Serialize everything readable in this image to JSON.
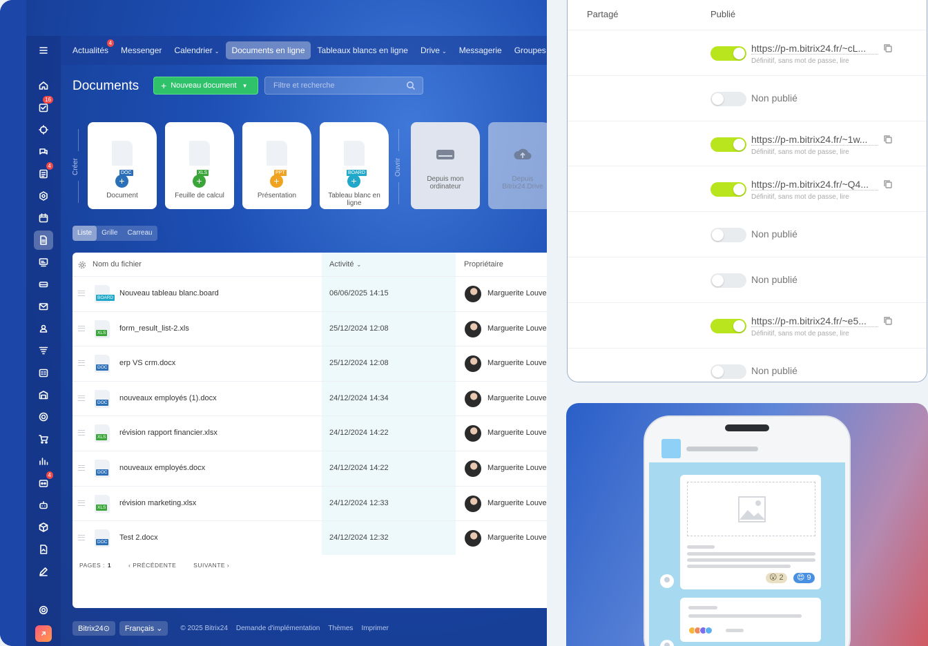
{
  "nav": {
    "items": [
      {
        "label": "Actualités",
        "badge": "4"
      },
      {
        "label": "Messenger"
      },
      {
        "label": "Calendrier",
        "caret": "⌄"
      },
      {
        "label": "Documents en ligne",
        "active": true
      },
      {
        "label": "Tableaux blancs en ligne"
      },
      {
        "label": "Drive",
        "caret": "⌄"
      },
      {
        "label": "Messagerie"
      },
      {
        "label": "Groupes"
      }
    ]
  },
  "sidebar": {
    "badge_tasks": "16",
    "badge_feed": "4",
    "badge_robot": "4"
  },
  "page": {
    "title": "Documents",
    "new_button": "Nouveau document",
    "search_placeholder": "Filtre et recherche"
  },
  "create": {
    "section_label": "Créer",
    "open_label": "Ouvrir",
    "cards": [
      {
        "label": "Document",
        "tag": "DOC"
      },
      {
        "label": "Feuille de calcul",
        "tag": "XLS"
      },
      {
        "label": "Présentation",
        "tag": "PPT"
      },
      {
        "label": "Tableau blanc en ligne",
        "tag": "BOARD"
      }
    ],
    "open_cards": [
      {
        "label": "Depuis mon ordinateur"
      },
      {
        "label": "Depuis Bitrix24.Drive"
      }
    ]
  },
  "view_tabs": [
    "Liste",
    "Grille",
    "Carreau"
  ],
  "table": {
    "col_name": "Nom du fichier",
    "col_activity": "Activité",
    "col_owner": "Propriétaire",
    "rows": [
      {
        "name": "Nouveau tableau blanc.board",
        "tag": "BOARD",
        "date": "06/06/2025 14:15",
        "owner": "Marguerite Louve"
      },
      {
        "name": "form_result_list-2.xls",
        "tag": "XLS",
        "date": "25/12/2024 12:08",
        "owner": "Marguerite Louve"
      },
      {
        "name": "erp VS crm.docx",
        "tag": "DOC",
        "date": "25/12/2024 12:08",
        "owner": "Marguerite Louve"
      },
      {
        "name": "nouveaux employés (1).docx",
        "tag": "DOC",
        "date": "24/12/2024 14:34",
        "owner": "Marguerite Louve"
      },
      {
        "name": "révision rapport financier.xlsx",
        "tag": "XLS",
        "date": "24/12/2024 14:22",
        "owner": "Marguerite Louve"
      },
      {
        "name": "nouveaux employés.docx",
        "tag": "DOC",
        "date": "24/12/2024 14:22",
        "owner": "Marguerite Louve"
      },
      {
        "name": "révision marketing.xlsx",
        "tag": "XLS",
        "date": "24/12/2024 12:33",
        "owner": "Marguerite Louve"
      },
      {
        "name": "Test 2.docx",
        "tag": "DOC",
        "date": "24/12/2024 12:32",
        "owner": "Marguerite Louve"
      }
    ],
    "pages_label": "PAGES :",
    "page_number": "1",
    "prev_label": "PRÉCÉDENTE",
    "next_label": "SUIVANTE"
  },
  "footer": {
    "brand": "Bitrix24",
    "language": "Français",
    "copyright": "© 2025 Bitrix24",
    "link_impl": "Demande d'implémentation",
    "link_themes": "Thèmes",
    "link_print": "Imprimer"
  },
  "publish": {
    "col_shared": "Partagé",
    "col_published": "Publié",
    "rows": [
      {
        "published": true,
        "link": "https://p-m.bitrix24.fr/~cL...",
        "sub": "Définitif, sans mot de passe, lire"
      },
      {
        "published": false,
        "label": "Non publié"
      },
      {
        "published": true,
        "link": "https://p-m.bitrix24.fr/~1w...",
        "sub": "Définitif, sans mot de passe, lire"
      },
      {
        "published": true,
        "link": "https://p-m.bitrix24.fr/~Q4...",
        "sub": "Définitif, sans mot de passe, lire"
      },
      {
        "published": false,
        "label": "Non publié"
      },
      {
        "published": false,
        "label": "Non publié"
      },
      {
        "published": true,
        "link": "https://p-m.bitrix24.fr/~e5...",
        "sub": "Définitif, sans mot de passe, lire"
      },
      {
        "published": false,
        "label": "Non publié"
      }
    ]
  },
  "phone": {
    "react1": "😮 2",
    "react2": "😍 9"
  },
  "colors": {
    "accent_green": "#2fc26b",
    "toggle_on": "#b8e51d",
    "doc": "#2a6fb8",
    "xls": "#3aa63a",
    "ppt": "#f0a321",
    "board": "#1fa8c9"
  }
}
